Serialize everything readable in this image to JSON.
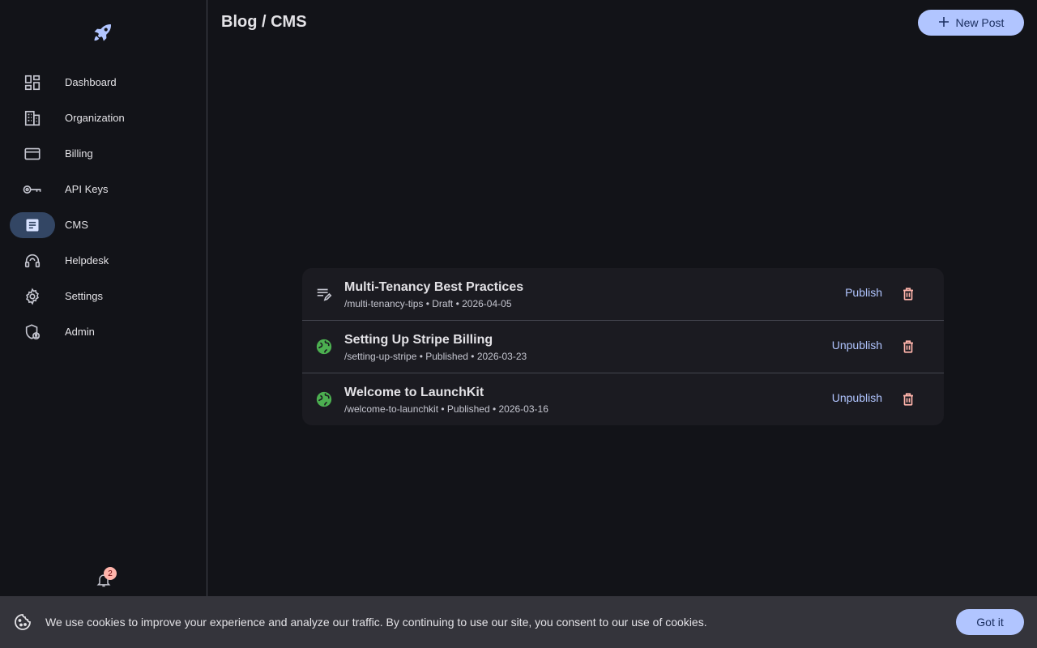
{
  "app": {
    "logo_icon": "rocket-icon",
    "page_title": "Blog / CMS",
    "accent_color": "#b1c5ff"
  },
  "header": {
    "new_post_label": "New Post",
    "new_post_icon": "plus-icon"
  },
  "sidebar": {
    "items": [
      {
        "label": "Dashboard",
        "icon": "dashboard-icon",
        "active": false
      },
      {
        "label": "Organization",
        "icon": "building-icon",
        "active": false
      },
      {
        "label": "Billing",
        "icon": "credit-card-icon",
        "active": false
      },
      {
        "label": "API Keys",
        "icon": "key-icon",
        "active": false
      },
      {
        "label": "CMS",
        "icon": "article-icon",
        "active": true
      },
      {
        "label": "Helpdesk",
        "icon": "headset-icon",
        "active": false
      },
      {
        "label": "Settings",
        "icon": "gear-icon",
        "active": false
      },
      {
        "label": "Admin",
        "icon": "admin-shield-icon",
        "active": false
      }
    ],
    "notifications_count": "2"
  },
  "posts": [
    {
      "title": "Multi-Tenancy Best Practices",
      "meta": "/multi-tenancy-tips • Draft • 2026-04-05",
      "status_icon": "edit-note-icon",
      "action_label": "Publish"
    },
    {
      "title": "Setting Up Stripe Billing",
      "meta": "/setting-up-stripe • Published • 2026-03-23",
      "status_icon": "globe-icon",
      "action_label": "Unpublish"
    },
    {
      "title": "Welcome to LaunchKit",
      "meta": "/welcome-to-launchkit • Published • 2026-03-16",
      "status_icon": "globe-icon",
      "action_label": "Unpublish"
    }
  ],
  "cookie_banner": {
    "text": "We use cookies to improve your experience and analyze our traffic. By continuing to use our site, you consent to our use of cookies.",
    "button_label": "Got it",
    "icon": "cookie-icon"
  }
}
